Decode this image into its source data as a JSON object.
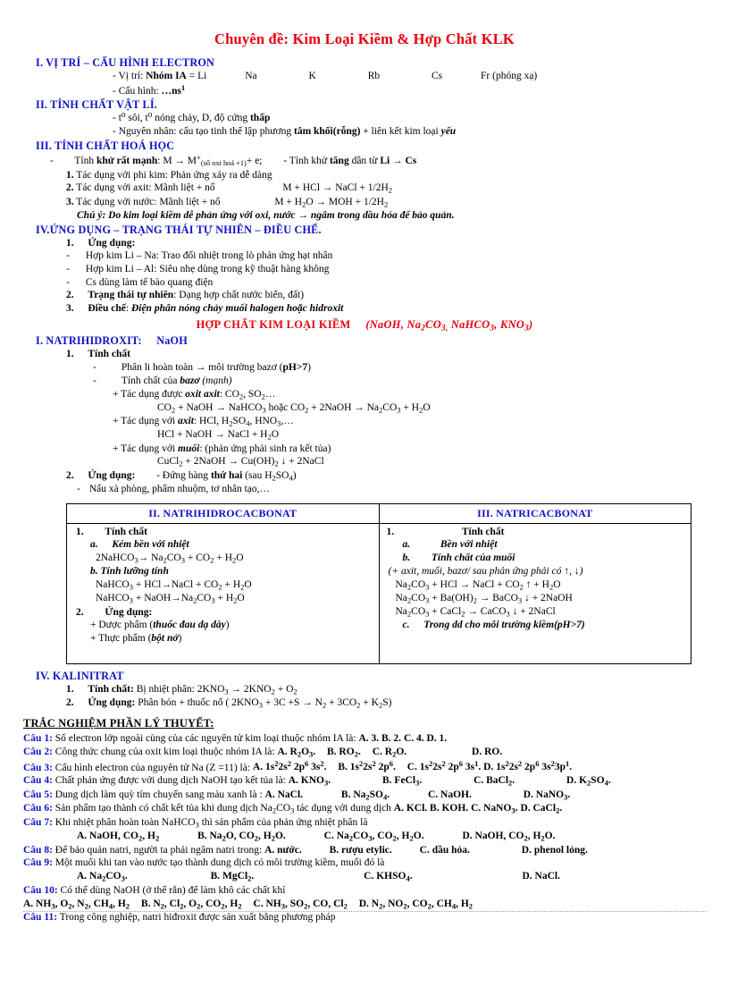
{
  "document": {
    "title": "Chuyên đề: Kim Loại Kiềm & Hợp Chất KLK",
    "subtitle_red": "HỢP CHẤT KIM LOẠI KIỀM",
    "subtitle_red_formula": "(NaOH, Na2CO3, NaHCO3, KNO3)"
  },
  "section1": {
    "heading": "I. VỊ TRÍ – CẤU HÌNH ELECTRON",
    "line1_prefix": "- Vị trí:",
    "line1_bold": "Nhóm IA",
    "line1_eq": "= Li",
    "elements": [
      "Na",
      "K",
      "Rb",
      "Cs",
      "Fr (phóng xạ)"
    ],
    "line2_prefix": "- Cấu hình:",
    "line2_value": "…ns",
    "line2_sup": "1"
  },
  "section2": {
    "heading": "II. TÍNH CHẤT VẬT LÍ.",
    "line1": "- t⁰ sôi, t⁰ nóng chảy, D, độ cứng",
    "line1_bold": "thấp",
    "line2_a": "- Nguyên nhân: cấu tạo tinh thể lập phương",
    "line2_b": "tâm khối(rỗng)",
    "line2_c": "+ liên kết kim loại",
    "line2_d": "yếu"
  },
  "section3": {
    "heading": "III. TÍNH CHẤT HOÁ HỌC",
    "lead_dash": "-",
    "lead_a": "Tính",
    "lead_b": "khử rất mạnh",
    "lead_c": ": M → M",
    "lead_sup": "+",
    "lead_sub": "(số oxi hoá +1)",
    "lead_d": "+ e;",
    "lead_e": "- Tính khử",
    "lead_f": "tăng",
    "lead_g": "dần từ",
    "lead_h": "Li → Cs",
    "items": [
      {
        "n": "1.",
        "text": "Tác dụng với phi kim:",
        "detail": "Phản ứng xảy ra dễ dàng",
        "eq": ""
      },
      {
        "n": "2.",
        "text": "Tác dụng với axit:",
        "detail": "Mãnh liệt + nổ",
        "eq": "M + HCl → NaCl + 1/2H2"
      },
      {
        "n": "3.",
        "text": "Tác dụng với nước:",
        "detail": "Mãnh liệt + nổ",
        "eq": "M + H2O → MOH + 1/2H2"
      }
    ],
    "note": "Chú ý: Do kim loại kiềm dễ phản ứng với oxi, nước → ngâm trong dầu hỏa để bảo quản."
  },
  "section4": {
    "heading": "IV.ỨNG DỤNG – TRẠNG THÁI TỰ NHIÊN – ĐIỀU CHẾ.",
    "item1_n": "1.",
    "item1_label": "Ứng dụng:",
    "bullets": [
      "Hợp kim Li – Na: Trao đổi nhiệt trong lò phản ứng hạt nhân",
      "Hợp kim Li – Al: Siêu nhẹ dùng trong kỹ thuật hàng không",
      "Cs dùng làm tế bào quang điện"
    ],
    "item2_n": "2.",
    "item2_label": "Trạng thái tự nhiên",
    "item2_text": ": Dạng hợp chất nước biển, đất)",
    "item3_n": "3.",
    "item3_label": "Điều chế",
    "item3_text": "Điện phân nóng chảy muối halogen hoặc hidroxit"
  },
  "naoh": {
    "heading": "I. NATRIHIDROXIT:",
    "heading_formula": "NaOH",
    "t1_n": "1.",
    "t1_label": "Tính chất",
    "b1_a": "Phân li hoàn toàn → môi trường bazơ (",
    "b1_b": "pH>7",
    "b1_c": ")",
    "b2_a": "Tính chất của",
    "b2_b": "bazơ",
    "b2_c": "(mạnh)",
    "p1_a": "+ Tác dụng được",
    "p1_b": "oxit axit",
    "p1_c": ": CO2, SO2…",
    "eq1": "CO2 + NaOH → NaHCO3 hoặc CO2 + 2NaOH → Na2CO3 + H2O",
    "p2_a": "+ Tác dụng với",
    "p2_b": "axit",
    "p2_c": ": HCl, H2SO4, HNO3,…",
    "eq2": "HCl + NaOH → NaCl + H2O",
    "p3_a": "+ Tác dụng với",
    "p3_b": "muối",
    "p3_c": ": (phản ứng phải sinh ra kết tủa)",
    "eq3": "CuCl2 + 2NaOH → Cu(OH)2 ↓ + 2NaCl",
    "t2_n": "2.",
    "t2_label": "Ứng dụng:",
    "t2_a": "- Đứng hàng",
    "t2_b": "thứ hai",
    "t2_c": "(sau H2SO4)",
    "t2_line2": "Nấu xà phòng, phẩm nhuộm, tơ nhân tạo,…"
  },
  "table": {
    "col1_header": "II. NATRIHIDROCACBONAT",
    "col2_header": "III. NATRICACBONAT",
    "col1": {
      "i1_n": "1.",
      "i1_label": "Tính chất",
      "a_n": "a.",
      "a_label": "Kém bền với nhiệt",
      "a_eq": "2NaHCO3 → Na2CO3 + CO2 + H2O",
      "b_n": "b.",
      "b_label": "Tính lưỡng tính",
      "b_eq1": "NaHCO3 + HCl→NaCl + CO2 + H2O",
      "b_eq2": "NaHCO3 + NaOH→Na2CO3 + H2O",
      "i2_n": "2.",
      "i2_label": "Ứng dụng:",
      "u1_a": "+ Dược phẩm (",
      "u1_b": "thuốc đau dạ dày",
      "u1_c": ")",
      "u2_a": "+ Thực phẩm (",
      "u2_b": "bột nở",
      "u2_c": ")"
    },
    "col2": {
      "i1_n": "1.",
      "i1_label": "Tính chất",
      "a_n": "a.",
      "a_label": "Bền với nhiệt",
      "b_n": "b.",
      "b_label": "Tính chất của muối",
      "b_note": "(+ axit, muối, bazơ/ sau phản ứng phải có ↑, ↓)",
      "b_eq1": "Na2CO3 + HCl → NaCl + CO2 ↑ + H2O",
      "b_eq2": "Na2CO3 + Ba(OH)2 → BaCO3 ↓ + 2NaOH",
      "b_eq3": "Na2CO3 + CaCl2 → CaCO3 ↓ + 2NaCl",
      "c_n": "c.",
      "c_label": "Trong dd cho môi trường kiềm(pH>7)"
    }
  },
  "kno3": {
    "heading": "IV. KALINITRAT",
    "i1_n": "1.",
    "i1_label": "Tính chất:",
    "i1_text": "Bị nhiệt phân: 2KNO3 → 2KNO2 + O2",
    "i2_n": "2.",
    "i2_label": "Ứng dụng:",
    "i2_text": "Phân bón + thuốc nổ ( 2KNO3 + 3C +S → N2 + 3CO2 + K2S)"
  },
  "quiz": {
    "heading": "TRẮC NGHIỆM PHẦN LÝ THUYẾT:",
    "questions": [
      {
        "label": "Câu 1:",
        "text": "Số electron lớp ngoài cùng của các nguyên tử kim loại thuộc nhóm IA là:",
        "options": [
          "A. 3.",
          "B. 2.",
          "C. 4.",
          "D. 1."
        ],
        "layout": "inline"
      },
      {
        "label": "Câu 2:",
        "text": "Công thức chung của oxit kim loại thuộc nhóm IA là:",
        "options": [
          "A. R2O3.",
          "B. RO2.",
          "C. R2O.",
          "D. RO."
        ],
        "layout": "inline"
      },
      {
        "label": "Câu 3:",
        "text": "Cấu hình electron của nguyên tử Na (Z =11) là:",
        "options": [
          "A. 1s22s2 2p6 3s2.",
          "B. 1s22s2 2p6.",
          "C. 1s22s2 2p6 3s1.",
          "D. 1s22s2 2p6 3s23p1."
        ],
        "layout": "inline"
      },
      {
        "label": "Câu 4:",
        "text": "Chất phản ứng được với dung dịch NaOH tạo kết tủa là:",
        "options": [
          "A. KNO3.",
          "B. FeCl3.",
          "C. BaCl2.",
          "D. K2SO4."
        ],
        "layout": "inline"
      },
      {
        "label": "Câu 5:",
        "text": "Dung dịch làm quỳ tím chuyển sang màu xanh là :",
        "options": [
          "A. NaCl.",
          "B. Na2SO4.",
          "C. NaOH.",
          "D. NaNO3."
        ],
        "layout": "inline"
      },
      {
        "label": "Câu 6:",
        "text": "Sản phẩm tạo thành có chất kết tủa khi dung dịch Na2CO3 tác dụng với dung dịch",
        "options": [
          "A. KCl.",
          "B. KOH.",
          "C. NaNO3.",
          "D. CaCl2."
        ],
        "layout": "inline"
      },
      {
        "label": "Câu 7:",
        "text": "Khi nhiệt phân hoàn toàn NaHCO3 thì sản phẩm của phản ứng nhiệt phân là",
        "options": [
          "A. NaOH, CO2, H2",
          "B. Na2O, CO2, H2O.",
          "C. Na2CO3, CO2, H2O.",
          "D. NaOH, CO2, H2O."
        ],
        "layout": "below"
      },
      {
        "label": "Câu 8:",
        "text": "Để bảo quản natri, người ta phải ngâm natri trong:",
        "options": [
          "A. nước.",
          "B. rượu etylic.",
          "C. dầu hỏa.",
          "D. phenol lỏng."
        ],
        "layout": "inline"
      },
      {
        "label": "Câu 9:",
        "text": "Một muối khi tan vào nước tạo thành dung dịch có môi trường kiềm, muối đó là",
        "options": [
          "A. Na2CO3.",
          "B. MgCl2.",
          "C. KHSO4.",
          "D. NaCl."
        ],
        "layout": "below"
      },
      {
        "label": "Câu 10:",
        "text": "Có thể dùng NaOH (ở thể rắn) để làm khô các chất khí",
        "options": [
          "A. NH3, O2, N2, CH4, H2",
          "B. N2, Cl2, O2, CO2, H2",
          "C. NH3, SO2, CO, Cl2",
          "D. N2, NO2, CO2, CH4, H2"
        ],
        "layout": "below-tight"
      },
      {
        "label": "Câu 11:",
        "text": "Trong công nghiệp, natri hiđroxit được sản xuất bằng phương pháp",
        "options": [],
        "layout": "none"
      }
    ]
  },
  "colors": {
    "title_red": "#e8000d",
    "heading_blue": "#1010c8",
    "text_black": "#000000"
  }
}
